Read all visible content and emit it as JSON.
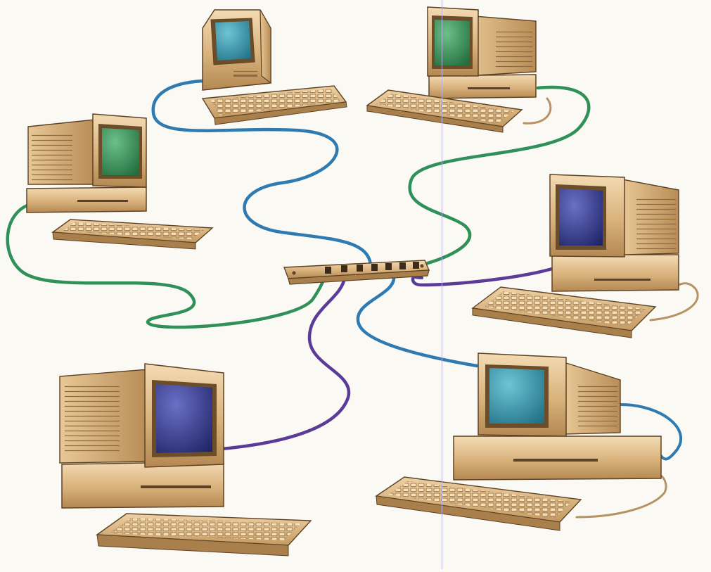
{
  "colors": {
    "background": "#fbf9f4",
    "beige_light": "#efd4ac",
    "beige": "#d9b27c",
    "beige_dark": "#a97f4c",
    "outline": "#5e4224",
    "cable_blue": "#2f7ab0",
    "cable_green": "#2f9058",
    "cable_purple": "#5a3c98",
    "cable_tan": "#b79265",
    "screen_teal": "#2d8fa6",
    "screen_green": "#2f8c4f",
    "screen_navy": "#28327e"
  },
  "nodes": [
    {
      "id": "compact-mac-top",
      "kind": "compact",
      "screen": "teal",
      "cable": "blue",
      "port": 5
    },
    {
      "id": "mac-top-right",
      "kind": "desktop",
      "screen": "green",
      "cable": "green",
      "port": 6
    },
    {
      "id": "mac-left",
      "kind": "desktop",
      "screen": "green",
      "cable": "green",
      "port": 1
    },
    {
      "id": "mac-right",
      "kind": "desktop",
      "screen": "navy",
      "cable": "purple",
      "port": 7
    },
    {
      "id": "mac-bottom-left",
      "kind": "desktop",
      "screen": "navy",
      "cable": "purple",
      "port": 2
    },
    {
      "id": "mac-bottom-right",
      "kind": "desktop",
      "screen": "teal",
      "cable": "blue",
      "port": 6
    }
  ],
  "hub": {
    "ports": 7
  }
}
